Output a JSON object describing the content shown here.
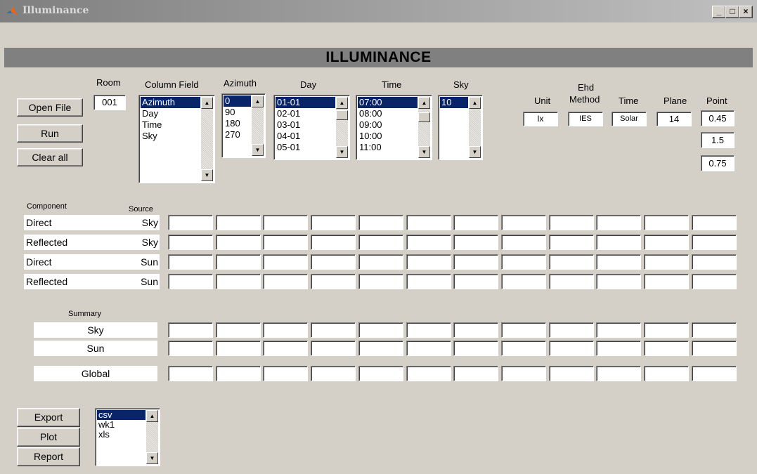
{
  "window": {
    "title": "Illuminance"
  },
  "header": {
    "title": "ILLUMINANCE"
  },
  "buttons": {
    "open_file": "Open File",
    "run": "Run",
    "clear_all": "Clear all",
    "export": "Export",
    "plot": "Plot",
    "report": "Report"
  },
  "room": {
    "label": "Room",
    "value": "001"
  },
  "column_field": {
    "label": "Column Field",
    "items": [
      "Azimuth",
      "Day",
      "Time",
      "Sky"
    ],
    "selected": "Azimuth"
  },
  "azimuth": {
    "label": "Azimuth",
    "items": [
      "0",
      "90",
      "180",
      "270"
    ],
    "selected": "0"
  },
  "day": {
    "label": "Day",
    "items": [
      "01-01",
      "02-01",
      "03-01",
      "04-01",
      "05-01"
    ],
    "selected": "01-01"
  },
  "time": {
    "label": "Time",
    "items": [
      "07:00",
      "08:00",
      "09:00",
      "10:00",
      "11:00"
    ],
    "selected": "07:00"
  },
  "sky": {
    "label": "Sky",
    "items": [
      "10"
    ],
    "selected": "10"
  },
  "params": {
    "unit_label": "Unit",
    "unit_value": "lx",
    "ehd_label_1": "Ehd",
    "ehd_label_2": "Method",
    "ehd_value": "IES",
    "time_label": "Time",
    "time_value": "Solar",
    "plane_label": "Plane",
    "plane_value": "14",
    "point_label": "Point",
    "point_values": [
      "0.45",
      "1.5",
      "0.75"
    ]
  },
  "components": {
    "component_header": "Component",
    "source_header": "Source",
    "rows": [
      {
        "component": "Direct",
        "source": "Sky"
      },
      {
        "component": "Reflected",
        "source": "Sky"
      },
      {
        "component": "Direct",
        "source": "Sun"
      },
      {
        "component": "Reflected",
        "source": "Sun"
      }
    ]
  },
  "summary": {
    "header": "Summary",
    "rows": [
      "Sky",
      "Sun"
    ],
    "global": "Global"
  },
  "export_format": {
    "items": [
      "csv",
      "wk1",
      "xls"
    ],
    "selected": "csv"
  },
  "colors": {
    "selection": "#0a246a",
    "background": "#d4d0c8",
    "header_bar": "#808080"
  }
}
